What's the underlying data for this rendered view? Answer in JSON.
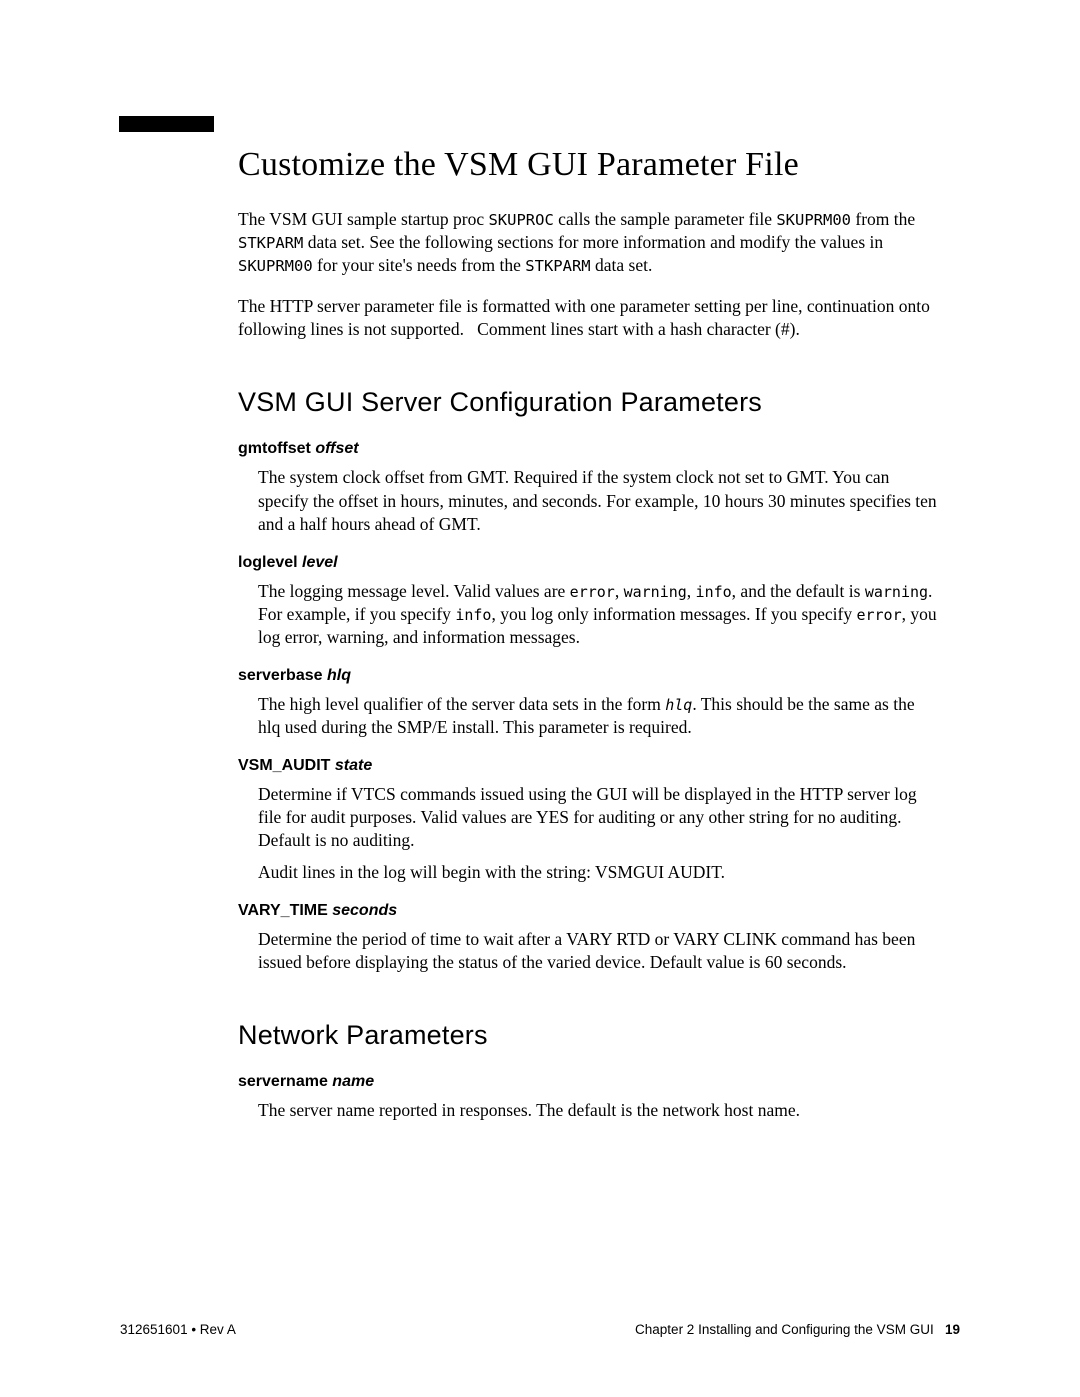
{
  "title": "Customize the VSM GUI Parameter File",
  "intro1_pre": "The VSM GUI sample startup proc ",
  "intro1_code1": "SKUPROC",
  "intro1_mid1": " calls the sample parameter file ",
  "intro1_code2": "SKUPRM00",
  "intro1_mid2": " from the ",
  "intro1_code3": "STKPARM",
  "intro1_mid3": " data set. See the following sections for more information and modify the values in ",
  "intro1_code4": "SKUPRM00",
  "intro1_mid4": " for your site's needs from the ",
  "intro1_code5": "STKPARM",
  "intro1_end": " data set.",
  "intro2_pre": "The HTTP server parameter file is formatted with one parameter setting per line, continuation onto following lines is not supported.",
  "intro2_post": " Comment lines start with a hash character (#).",
  "section_server": "VSM GUI Server Configuration Parameters",
  "params_server": [
    {
      "name": "gmtoffset",
      "arg": "offset",
      "desc": [
        {
          "text": "The system clock offset from GMT. Required if the system clock not set to GMT. You can specify the offset in hours, minutes, and seconds. For example, 10 hours 30 minutes specifies ten and a half hours ahead of GMT."
        }
      ]
    },
    {
      "name": "loglevel",
      "arg": "level",
      "desc": [
        {
          "rich": true,
          "parts": [
            {
              "t": "The logging message level. Valid values are "
            },
            {
              "c": "error"
            },
            {
              "t": ", "
            },
            {
              "c": "warning"
            },
            {
              "t": ", "
            },
            {
              "c": "info"
            },
            {
              "t": ", and the default is "
            },
            {
              "c": "warning"
            },
            {
              "t": ". For example, if you specify "
            },
            {
              "c": "info"
            },
            {
              "t": ", you log only information messages. If you specify  "
            },
            {
              "c": "error"
            },
            {
              "t": ", you log error, warning, and information messages."
            }
          ]
        }
      ]
    },
    {
      "name": "serverbase",
      "arg": "hlq",
      "desc": [
        {
          "rich": true,
          "parts": [
            {
              "t": "The high level qualifier of the server data sets in the form "
            },
            {
              "ci": "hlq"
            },
            {
              "t": ". This should be the same as the hlq used during the SMP/E install. This parameter is required."
            }
          ]
        }
      ]
    },
    {
      "name": "VSM_AUDIT",
      "arg": "state",
      "desc": [
        {
          "text": "Determine if VTCS commands issued using the GUI will be displayed in the HTTP server log file for audit purposes. Valid values are YES for auditing or any other string for no auditing. Default is no auditing."
        },
        {
          "text": "Audit lines in the log will begin with the string: VSMGUI AUDIT."
        }
      ]
    },
    {
      "name": "VARY_TIME",
      "arg": "seconds",
      "desc": [
        {
          "text": "Determine the period of time to wait after a VARY RTD or VARY CLINK command has been issued before displaying the status of the varied device. Default value is 60 seconds."
        }
      ]
    }
  ],
  "section_network": "Network Parameters",
  "params_network": [
    {
      "name": "servername",
      "arg": "name",
      "desc": [
        {
          "text": "The server name reported in responses. The default is the network host name."
        }
      ]
    }
  ],
  "footer": {
    "left": "312651601 • Rev A",
    "right_chapter": "Chapter 2 Installing and Configuring the VSM GUI",
    "right_page": "19"
  }
}
